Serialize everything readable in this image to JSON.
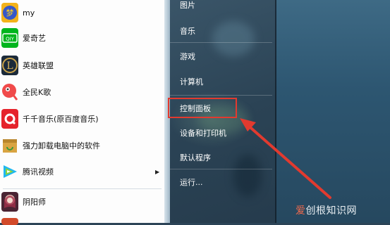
{
  "programs": [
    {
      "label": "my",
      "icon": "game-tiger-icon",
      "color": "#f2b21b"
    },
    {
      "label": "爱奇艺",
      "icon": "iqiyi-icon",
      "color": "#00b51d"
    },
    {
      "label": "英雄联盟",
      "icon": "league-of-legends-icon",
      "color": "#1b2a3a"
    },
    {
      "label": "全民K歌",
      "icon": "karaoke-icon",
      "color": "#f04a4a"
    },
    {
      "label": "千千音乐(原百度音乐)",
      "icon": "qianqian-music-icon",
      "color": "#e5232b"
    },
    {
      "label": "强力卸载电脑中的软件",
      "icon": "uninstall-box-icon",
      "color": "#d9a441"
    },
    {
      "label": "腾讯视频",
      "icon": "tencent-video-icon",
      "color": "#1fb7f0"
    },
    {
      "label": "阴阳师",
      "icon": "onmyoji-icon",
      "color": "#a0304a"
    }
  ],
  "right_menu": {
    "pictures": "图片",
    "music": "音乐",
    "games": "游戏",
    "computer": "计算机",
    "control_panel": "控制面板",
    "devices_printers": "设备和打印机",
    "default_programs": "默认程序",
    "run": "运行..."
  },
  "annotation_color": "#e23a2f",
  "watermark": {
    "prefix": "爱",
    "rest": "创根知识网"
  }
}
